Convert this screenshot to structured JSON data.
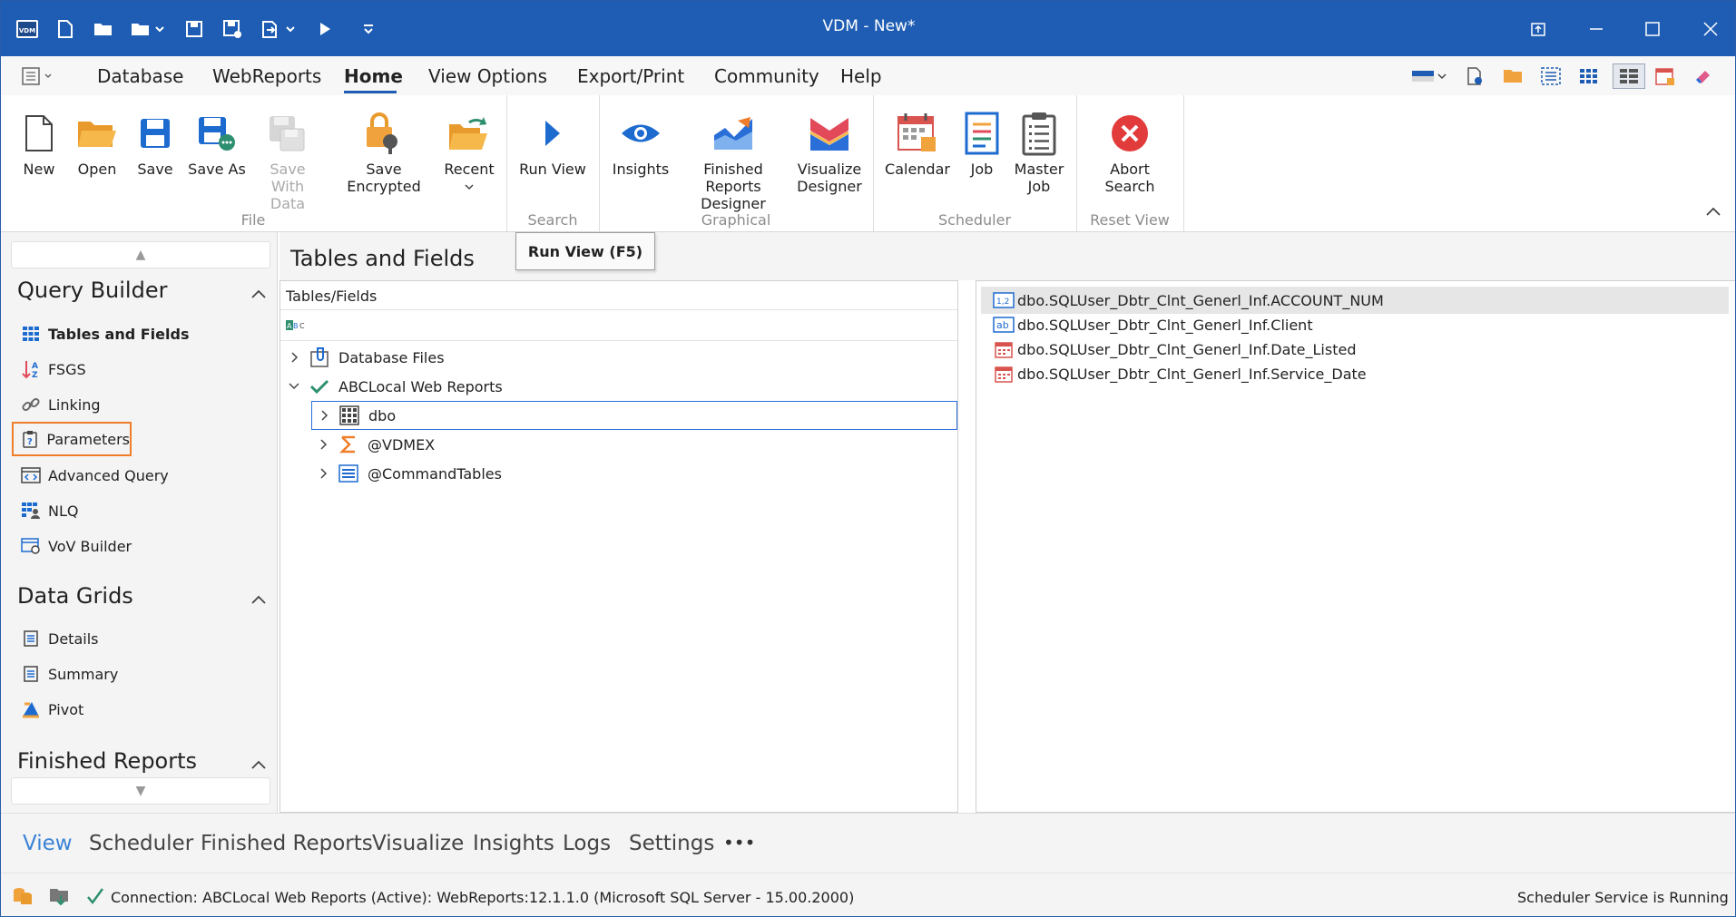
{
  "title_bar": {
    "app_icon": "VDM",
    "title": "VDM - New*",
    "quick_access": [
      "new-file-icon",
      "open-folder-icon",
      "open-recent-icon",
      "save-icon",
      "save-as-icon",
      "export-icon",
      "run-icon",
      "customize-icon"
    ]
  },
  "menu": {
    "items": [
      {
        "label": "Database"
      },
      {
        "label": "WebReports"
      },
      {
        "label": "Home"
      },
      {
        "label": "View Options"
      },
      {
        "label": "Export/Print"
      },
      {
        "label": "Community"
      },
      {
        "label": "Help"
      }
    ],
    "active": "Home"
  },
  "ribbon": {
    "groups": {
      "file": "File",
      "search": "Search",
      "graphical": "Graphical",
      "scheduler": "Scheduler",
      "reset_view": "Reset View"
    },
    "buttons": {
      "new": "New",
      "open": "Open",
      "save": "Save",
      "save_as": "Save As",
      "save_with_data_1": "Save With",
      "save_with_data_2": "Data",
      "save_encrypted": "Save Encrypted",
      "recent": "Recent",
      "run_view": "Run View",
      "insights": "Insights",
      "finished_reports_1": "Finished Reports",
      "finished_reports_2": "Designer",
      "visualize_1": "Visualize",
      "visualize_2": "Designer",
      "calendar": "Calendar",
      "job": "Job",
      "master_job_1": "Master",
      "master_job_2": "Job",
      "abort_1": "Abort",
      "abort_2": "Search"
    }
  },
  "tooltip": "Run View (F5)",
  "left_nav": {
    "query_builder": {
      "title": "Query Builder",
      "items": [
        "Tables and Fields",
        "FSGS",
        "Linking",
        "Parameters",
        "Advanced Query",
        "NLQ",
        "VoV Builder"
      ]
    },
    "data_grids": {
      "title": "Data Grids",
      "items": [
        "Details",
        "Summary",
        "Pivot"
      ]
    },
    "finished_reports": {
      "title": "Finished Reports"
    }
  },
  "center": {
    "title": "Tables and Fields",
    "tree_header": "Tables/Fields",
    "tree": [
      {
        "label": "Database Files",
        "expanded": false
      },
      {
        "label": "ABCLocal Web Reports",
        "expanded": true
      },
      {
        "label": "dbo",
        "expanded": false
      },
      {
        "label": "@VDMEX",
        "expanded": false
      },
      {
        "label": "@CommandTables",
        "expanded": false
      }
    ]
  },
  "fields": [
    "dbo.SQLUser_Dbtr_Clnt_Generl_Inf.ACCOUNT_NUM",
    "dbo.SQLUser_Dbtr_Clnt_Generl_Inf.Client",
    "dbo.SQLUser_Dbtr_Clnt_Generl_Inf.Date_Listed",
    "dbo.SQLUser_Dbtr_Clnt_Generl_Inf.Service_Date"
  ],
  "bottom_tabs": {
    "items": [
      "View",
      "Scheduler",
      "Finished Reports",
      "Visualize",
      "Insights",
      "Logs",
      "Settings"
    ],
    "more": "•••",
    "active": "View"
  },
  "status": {
    "connection": "Connection: ABCLocal Web Reports (Active): WebReports:12.1.1.0 (Microsoft SQL Server - 15.00.2000)",
    "scheduler": "Scheduler Service is Running"
  },
  "colors": {
    "accent": "#1e5db3",
    "highlight_outline": "#ef7d2a",
    "active_tab": "#3a83d6"
  }
}
